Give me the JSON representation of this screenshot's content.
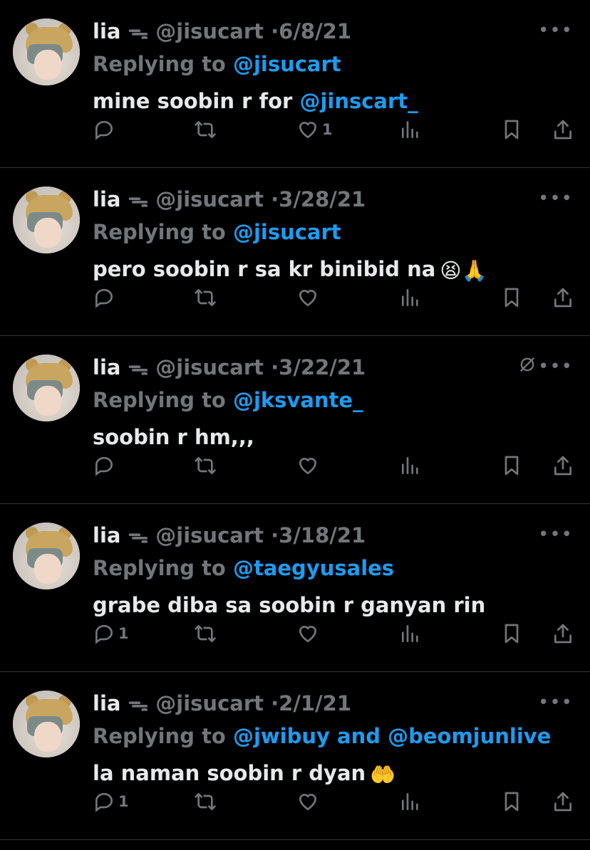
{
  "tweets": [
    {
      "name": "lia",
      "glyph": "ᯓ",
      "handle": "@jisucart",
      "date": "6/8/21",
      "reply_label": "Replying to",
      "reply_to": "@jisucart",
      "text": "mine soobin r for ",
      "text_mention": "@jinscart_",
      "emoji": "",
      "reply_count": "",
      "like_count": "1"
    },
    {
      "name": "lia",
      "glyph": "ᯓ",
      "handle": "@jisucart",
      "date": "3/28/21",
      "reply_label": "Replying to",
      "reply_to": "@jisucart",
      "text": "pero soobin r sa kr binibid na",
      "text_mention": "",
      "emoji": "😫🙏",
      "reply_count": "",
      "like_count": ""
    },
    {
      "name": "lia",
      "glyph": "ᯓ",
      "handle": "@jisucart",
      "date": "3/22/21",
      "reply_label": "Replying to",
      "reply_to": "@jksvante_",
      "text": "soobin r hm,,,",
      "text_mention": "",
      "emoji": "",
      "reply_count": "",
      "like_count": ""
    },
    {
      "name": "lia",
      "glyph": "ᯓ",
      "handle": "@jisucart",
      "date": "3/18/21",
      "reply_label": "Replying to",
      "reply_to": "@taegyusales",
      "text": "grabe diba sa soobin r ganyan rin",
      "text_mention": "",
      "emoji": "",
      "reply_count": "1",
      "like_count": ""
    },
    {
      "name": "lia",
      "glyph": "ᯓ",
      "handle": "@jisucart",
      "date": "2/1/21",
      "reply_label": "Replying to",
      "reply_to": "@jwibuy and @beomjunlive",
      "text": "la naman soobin r dyan",
      "text_mention": "",
      "emoji": "🤲",
      "reply_count": "1",
      "like_count": ""
    }
  ],
  "icons": {
    "reply": "reply-icon",
    "retweet": "retweet-icon",
    "like": "heart-icon",
    "views": "views-icon",
    "bookmark": "bookmark-icon",
    "share": "share-icon",
    "more": "more-icon"
  },
  "colors": {
    "background": "#000000",
    "text": "#e7e9ea",
    "dim": "#71767b",
    "mention": "#1d9bf0"
  }
}
